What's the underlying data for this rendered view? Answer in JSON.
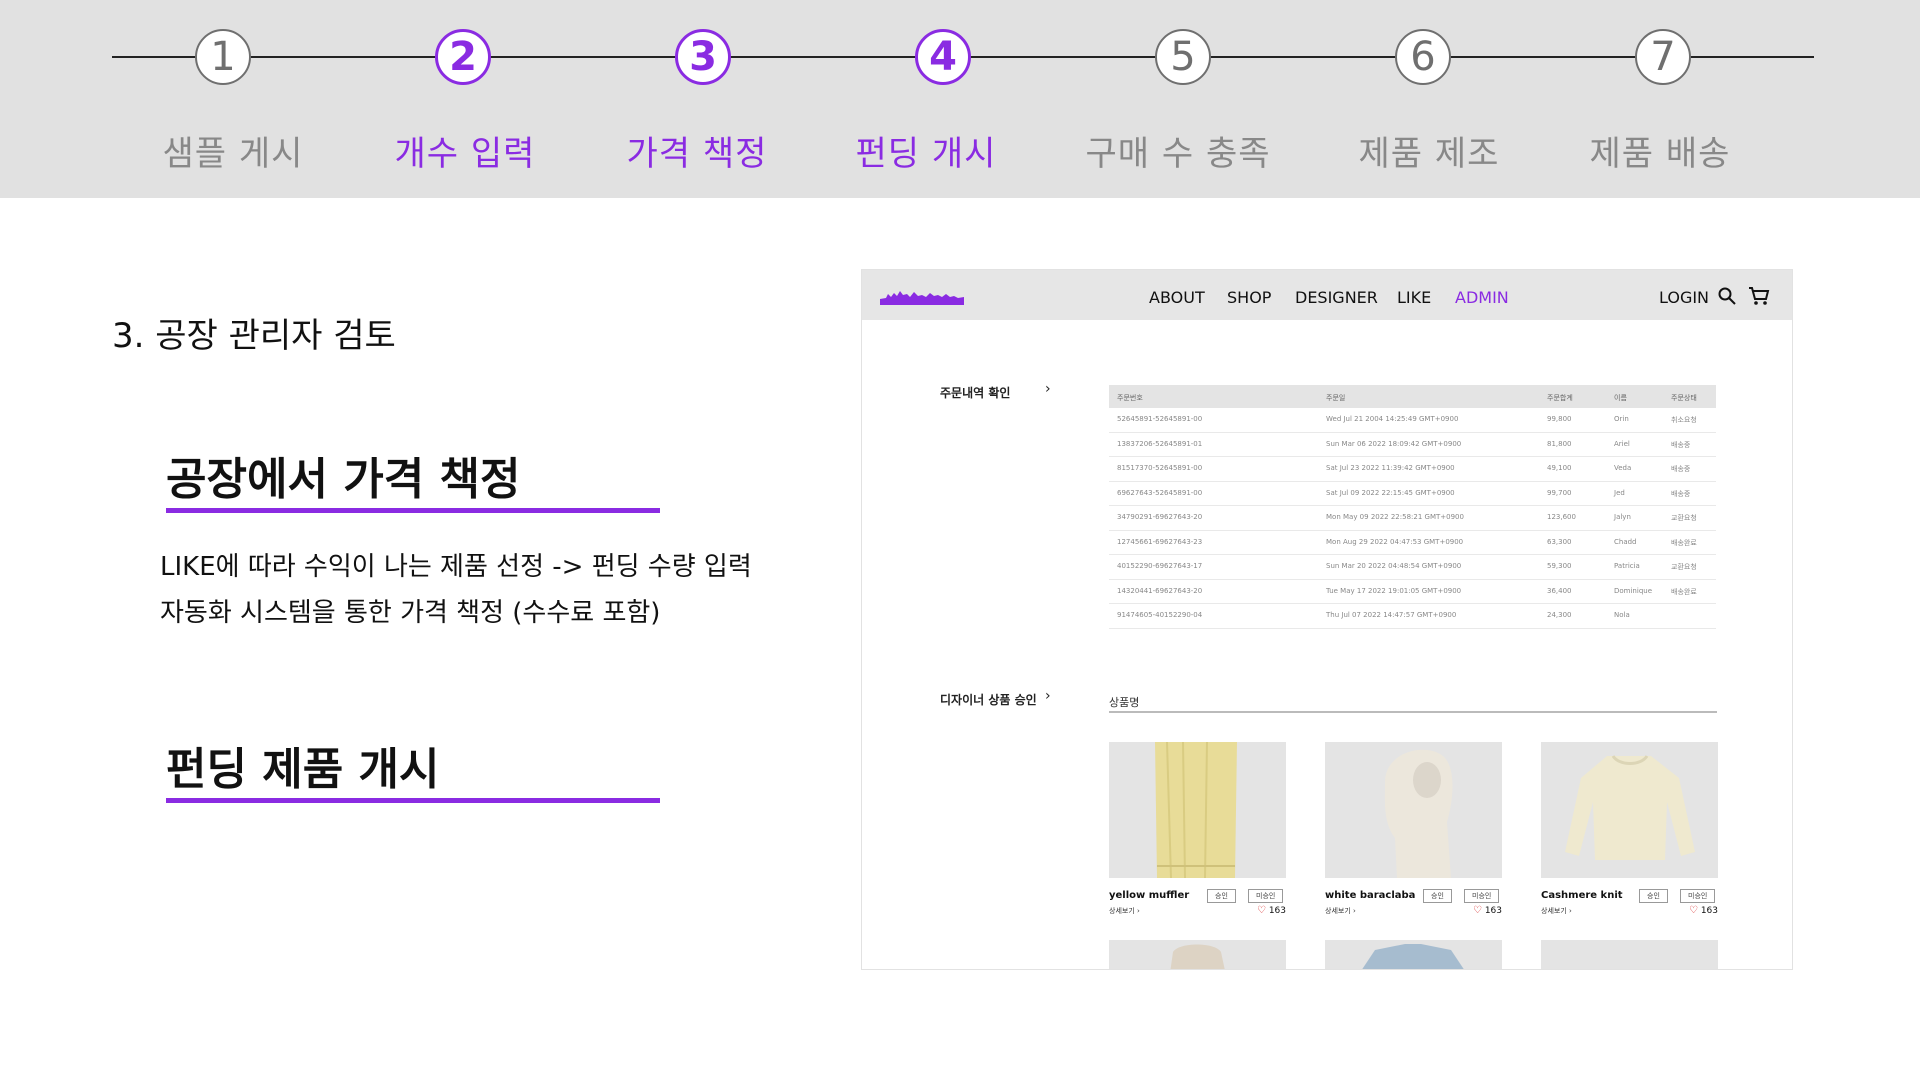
{
  "steps": [
    {
      "num": "1",
      "label": "샘플 게시",
      "active": false
    },
    {
      "num": "2",
      "label": "개수 입력",
      "active": true
    },
    {
      "num": "3",
      "label": "가격 책정",
      "active": true
    },
    {
      "num": "4",
      "label": "펀딩 개시",
      "active": true
    },
    {
      "num": "5",
      "label": "구매 수 충족",
      "active": false
    },
    {
      "num": "6",
      "label": "제품 제조",
      "active": false
    },
    {
      "num": "7",
      "label": "제품 배송",
      "active": false
    }
  ],
  "section_title": "3. 공장 관리자 검토",
  "heading1": "공장에서 가격 책정",
  "desc_line1": "LIKE에 따라 수익이 나는 제품 선정 -> 펀딩 수량 입력",
  "desc_line2": "자동화 시스템을 통한 가격 책정 (수수료 포함)",
  "heading2": "펀딩 제품 개시",
  "accent_color": "#8a2be2",
  "mockup": {
    "nav": {
      "about": "ABOUT",
      "shop": "SHOP",
      "designer": "DESIGNER",
      "like": "LIKE",
      "admin": "ADMIN",
      "login": "LOGIN"
    },
    "orders_label": "주문내역 확인",
    "orders_header": {
      "id": "주문번호",
      "date": "주문일",
      "total": "주문합계",
      "name": "이름",
      "status": "주문상태"
    },
    "orders": [
      {
        "id": "52645891-52645891-00",
        "date": "Wed Jul 21 2004 14:25:49 GMT+0900",
        "total": "99,800",
        "name": "Orin",
        "status": "취소요청"
      },
      {
        "id": "13837206-52645891-01",
        "date": "Sun Mar 06 2022 18:09:42 GMT+0900",
        "total": "81,800",
        "name": "Ariel",
        "status": "배송중"
      },
      {
        "id": "81517370-52645891-00",
        "date": "Sat Jul 23 2022 11:39:42 GMT+0900",
        "total": "49,100",
        "name": "Veda",
        "status": "배송중"
      },
      {
        "id": "69627643-52645891-00",
        "date": "Sat Jul 09 2022 22:15:45 GMT+0900",
        "total": "99,700",
        "name": "Jed",
        "status": "배송중"
      },
      {
        "id": "34790291-69627643-20",
        "date": "Mon May 09 2022 22:58:21 GMT+0900",
        "total": "123,600",
        "name": "Jalyn",
        "status": "교환요청"
      },
      {
        "id": "12745661-69627643-23",
        "date": "Mon Aug 29 2022 04:47:53 GMT+0900",
        "total": "63,300",
        "name": "Chadd",
        "status": "배송완료"
      },
      {
        "id": "40152290-69627643-17",
        "date": "Sun Mar 20 2022 04:48:54 GMT+0900",
        "total": "59,300",
        "name": "Patricia",
        "status": "교환요청"
      },
      {
        "id": "14320441-69627643-20",
        "date": "Tue May 17 2022 19:01:05 GMT+0900",
        "total": "36,400",
        "name": "Dominique",
        "status": "배송완료"
      },
      {
        "id": "91474605-40152290-04",
        "date": "Thu Jul 07 2022 14:47:57 GMT+0900",
        "total": "24,300",
        "name": "Nola",
        "status": ""
      }
    ],
    "approval_label": "디자이너 상품 승인",
    "product_name_label": "상품명",
    "products": [
      {
        "name": "yellow muffler",
        "more": "상세보기",
        "approve": "승인",
        "reject": "미승인",
        "likes": "163"
      },
      {
        "name": "white baraclaba",
        "more": "상세보기",
        "approve": "승인",
        "reject": "미승인",
        "likes": "163"
      },
      {
        "name": "Cashmere knit",
        "more": "상세보기",
        "approve": "승인",
        "reject": "미승인",
        "likes": "163"
      }
    ]
  }
}
